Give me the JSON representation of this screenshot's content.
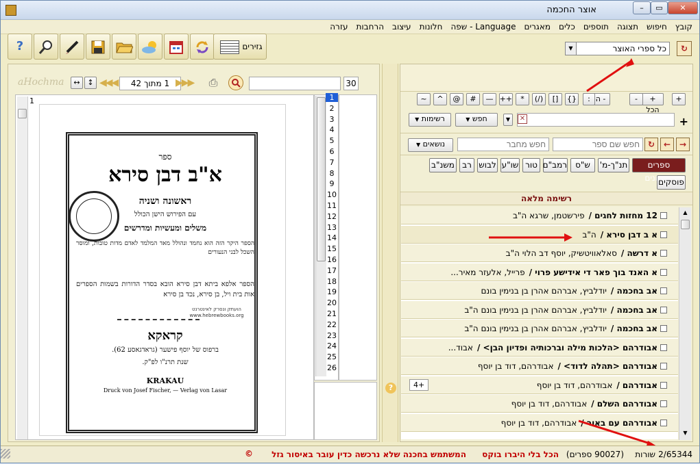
{
  "window": {
    "title": "אוצר החכמה",
    "minimize": "–",
    "maximize": "▭",
    "close": "✕"
  },
  "menu": [
    "קובץ",
    "חיפוש",
    "תצוגה",
    "תוספים",
    "כלים",
    "מאגרים",
    "Language - שפה",
    "חלונות",
    "עיצוב",
    "הרחבות",
    "עזרה"
  ],
  "toolbar": {
    "gazirim_label": "גזירים",
    "icons": [
      "help-icon",
      "search-magnifier-icon",
      "pen-icon",
      "save-icon",
      "open-folder-icon",
      "weather-icon",
      "calendar-icon",
      "refresh-icon"
    ]
  },
  "library": {
    "selected": "כל ספרי האוצר"
  },
  "viewer": {
    "brand": "aHochma",
    "page_of": "1 מתוך 42",
    "zoom": "30",
    "page_numbers": [
      "1",
      "2",
      "3",
      "4",
      "5",
      "6",
      "7",
      "8",
      "9",
      "10",
      "11",
      "12",
      "13",
      "14",
      "15",
      "16",
      "17",
      "18",
      "19",
      "20",
      "21",
      "22",
      "23",
      "24",
      "25",
      "26"
    ],
    "corner_number": "1"
  },
  "book_page": {
    "header": "ספר",
    "title": "א\"ב דבן סירא",
    "sub1": "ראשונה ושניה",
    "sub2": "עם הפירוש הישן הכולל",
    "sub3": "משלים ומעשיות ומדרשים",
    "para1": "הספר היקר הזה הוא נחמד ונהולל מאד המלמד לאדם מדות טובות, ומוסר השכל לבני הנעורים",
    "para2": "הספר אלפא ביתא דבן סירא הובא בסדר הדורות בשמות הספרים אות בית ויל, בן סירא, נכד בן סירא",
    "city": "קראקא",
    "printer": "ברפוס של יוסף פישער (גראדגאסע 62).",
    "year": "שנת תרנ\"ו לפ\"ק.",
    "latin_city": "KRAKAU",
    "latin_printer": "Druck von Josef Fischer, — Verlag von Lasar",
    "stamp_text": "hebrewbooks.org",
    "hb_note": "הועתק ונסרק לאינטרנט www.hebrewbooks.org"
  },
  "search": {
    "operators": [
      "+",
      "+ הכל",
      "-",
      "- הכל",
      ":",
      "{}",
      "[]",
      "(/)",
      "*",
      "++",
      "—",
      "#",
      "@",
      "^",
      "~"
    ],
    "search_button": "חפש",
    "lists_button": "רשימות",
    "book_name_placeholder": "חפש שם ספר",
    "author_placeholder": "חפש מחבר",
    "topics_button": "נושאים"
  },
  "categories": [
    "ספרים אחרונים",
    "תנ\"ך-מ'",
    "ש\"ס",
    "רמב\"ם",
    "טור",
    "שו\"ע",
    "לבוש",
    "רב",
    "משנ\"ב",
    "פוסקים"
  ],
  "list_title": "רשימה מלאה",
  "rows": [
    {
      "title": "12 מחזות לחגים /",
      "author": "פירשטמן, שרגא ה\"ב"
    },
    {
      "title": "א ב דבן סירא /",
      "author": "ה\"ב"
    },
    {
      "title": "א דרשה /",
      "author": "סאלאוויטשיק, יוסף דב הלוי ה\"ב"
    },
    {
      "title": "א האנד בוך פאר די אידישע פרוי /",
      "author": "פרייל, אלעזר מאיר..."
    },
    {
      "title": "אב בחכמה /",
      "author": "יודלביץ, אברהם אהרן בן בנימין בונם"
    },
    {
      "title": "אב בחכמה /",
      "author": "יודלביץ, אברהם אהרן בן בנימין בונם ה\"ב"
    },
    {
      "title": "אב בחכמה /",
      "author": "יודלביץ, אברהם אהרן בן בנימין בונם ה\"ב"
    },
    {
      "title": "אבודרהם <הלכות מילה וברכותיה ופדיון הבן> /",
      "author": "אבוד..."
    },
    {
      "title": "אבודרהם <תהלה לדוד> /",
      "author": "אבודרהם, דוד בן יוסף"
    },
    {
      "title": "אבודרהם /",
      "author": "אבודרהם, דוד בן יוסף",
      "badge": "+4"
    },
    {
      "title": "אבודרהם השלם /",
      "author": "אבודרהם, דוד בן יוסף"
    },
    {
      "title": "אבודרהם עם באור /",
      "author": "אבודרהם, דוד בן יוסף"
    }
  ],
  "status": {
    "count": "2/65344",
    "rows_word": "שורות",
    "books": "(90027 ספרים)",
    "notice": "הכל בלי היברו בוקס",
    "warning": "המשתמש בחכנה שלא נרכשה כדין עובר באיסור גזל",
    "copyright": "©"
  },
  "colors": {
    "accent_red": "#c00000",
    "panel": "#f2efd4",
    "selected_tab": "#7a1d1d",
    "page_highlight": "#1f5fd6"
  }
}
